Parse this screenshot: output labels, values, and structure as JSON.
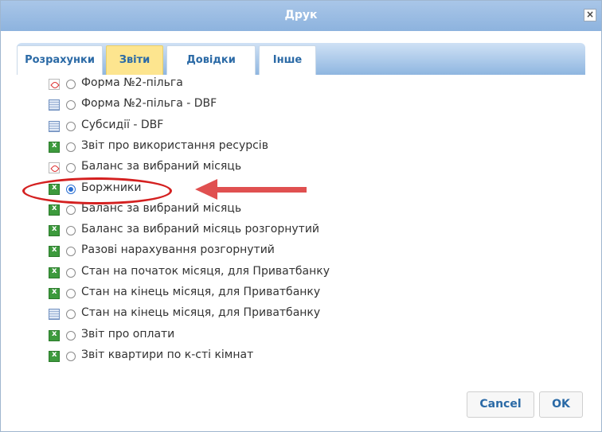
{
  "dialog": {
    "title": "Друк",
    "close_label": "×"
  },
  "tabs": [
    {
      "label": "Розрахунки",
      "active": false
    },
    {
      "label": "Звіти",
      "active": true
    },
    {
      "label": "Довідки",
      "active": false
    },
    {
      "label": "Інше",
      "active": false
    }
  ],
  "reports": [
    {
      "label": "Форма №2-пільга",
      "icon": "pdf-icon",
      "selected": false
    },
    {
      "label": "Форма №2-пільга - DBF",
      "icon": "dbf-table-icon",
      "selected": false
    },
    {
      "label": "Субсидії - DBF",
      "icon": "dbf-table-icon",
      "selected": false
    },
    {
      "label": "Звіт про використання ресурсів",
      "icon": "excel-icon",
      "selected": false
    },
    {
      "label": "Баланс за вибраний місяць",
      "icon": "pdf-icon",
      "selected": false
    },
    {
      "label": "Боржники",
      "icon": "excel-icon",
      "selected": true
    },
    {
      "label": "Баланс за вибраний місяць",
      "icon": "excel-icon",
      "selected": false
    },
    {
      "label": "Баланс за вибраний місяць розгорнутий",
      "icon": "excel-icon",
      "selected": false
    },
    {
      "label": "Разові нарахування розгорнутий",
      "icon": "excel-icon",
      "selected": false
    },
    {
      "label": "Стан на початок місяця, для Приватбанку",
      "icon": "excel-icon",
      "selected": false
    },
    {
      "label": "Стан на кінець місяця, для Приватбанку",
      "icon": "excel-icon",
      "selected": false
    },
    {
      "label": "Стан на кінець місяця, для Приватбанку",
      "icon": "dbf-table-icon",
      "selected": false
    },
    {
      "label": "Звіт про оплати",
      "icon": "excel-icon",
      "selected": false
    },
    {
      "label": "Звіт квартири по к-сті кімнат",
      "icon": "excel-icon",
      "selected": false
    }
  ],
  "annotation": {
    "highlight_color": "#d42020",
    "arrow_color": "#e05050"
  },
  "buttons": {
    "cancel_label": "Cancel",
    "ok_label": "OK"
  }
}
